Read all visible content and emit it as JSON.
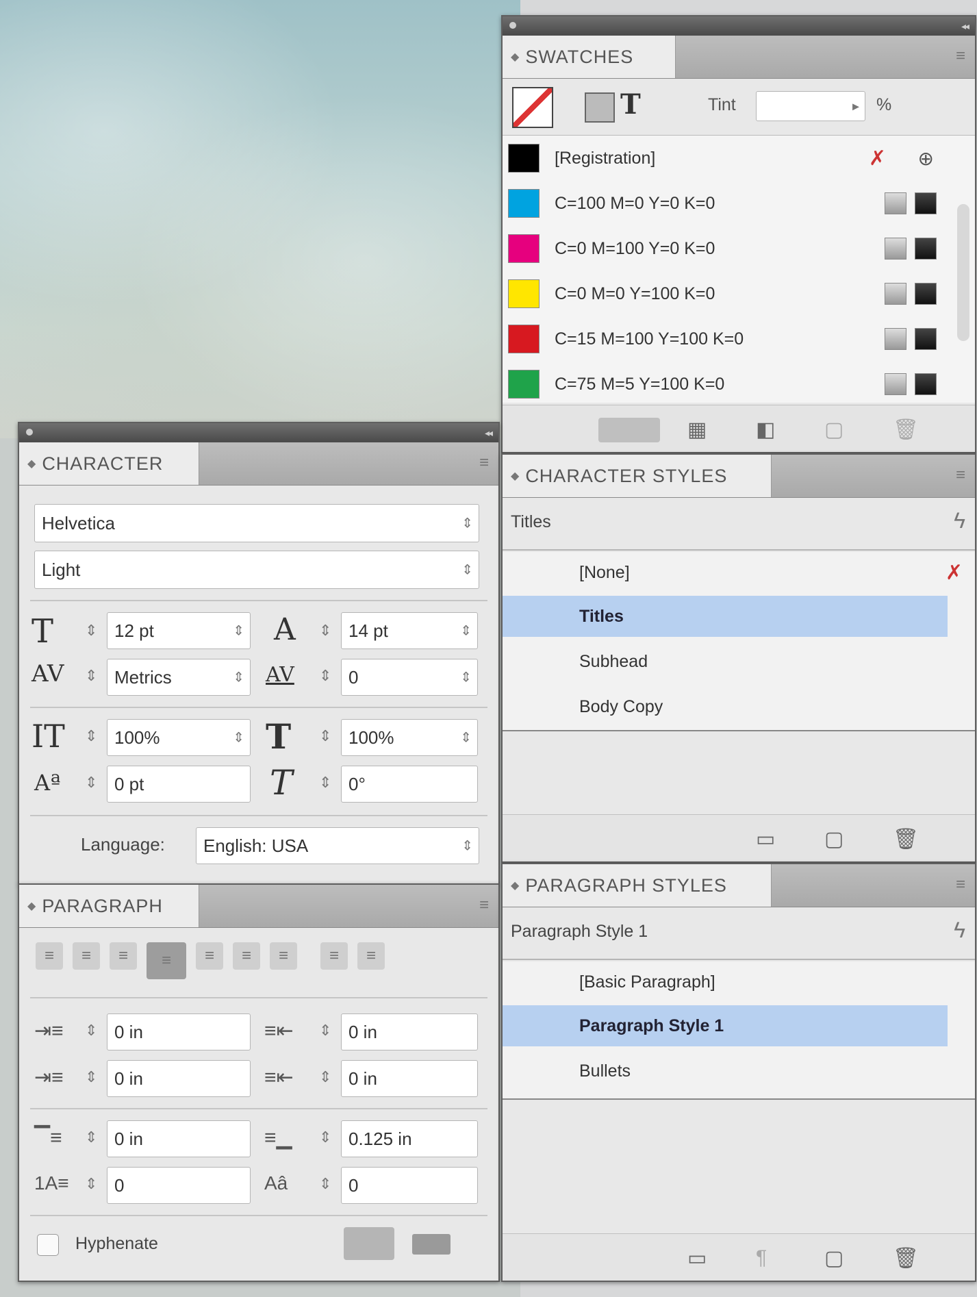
{
  "swatches": {
    "tab": "SWATCHES",
    "tint_label": "Tint",
    "tint_unit": "%",
    "items": [
      {
        "name": "[Registration]",
        "color": "#000000"
      },
      {
        "name": "C=100 M=0 Y=0 K=0",
        "color": "#00a3e0"
      },
      {
        "name": "C=0 M=100 Y=0 K=0",
        "color": "#e6007e"
      },
      {
        "name": "C=0 M=0 Y=100 K=0",
        "color": "#ffe600"
      },
      {
        "name": "C=15 M=100 Y=100 K=0",
        "color": "#d71920"
      },
      {
        "name": "C=75 M=5 Y=100 K=0",
        "color": "#1fa34a"
      }
    ]
  },
  "character": {
    "tab": "CHARACTER",
    "font_family": "Helvetica",
    "font_style": "Light",
    "font_size": "12 pt",
    "leading": "14 pt",
    "kerning": "Metrics",
    "tracking": "0",
    "vertical_scale": "100%",
    "horizontal_scale": "100%",
    "baseline_shift": "0 pt",
    "skew": "0°",
    "language_label": "Language:",
    "language": "English: USA"
  },
  "character_styles": {
    "tab": "CHARACTER STYLES",
    "current": "Titles",
    "items": [
      "[None]",
      "Titles",
      "Subhead",
      "Body Copy"
    ],
    "selected_index": 1
  },
  "paragraph": {
    "tab": "PARAGRAPH",
    "left_indent": "0 in",
    "right_indent": "0 in",
    "first_line_indent": "0 in",
    "last_line_indent": "0 in",
    "space_before": "0 in",
    "space_after": "0.125 in",
    "drop_cap_lines": "0",
    "drop_cap_chars": "0",
    "hyphenate_label": "Hyphenate"
  },
  "paragraph_styles": {
    "tab": "PARAGRAPH STYLES",
    "current": "Paragraph Style 1",
    "items": [
      "[Basic Paragraph]",
      "Paragraph Style 1",
      "Bullets"
    ],
    "selected_index": 1
  }
}
